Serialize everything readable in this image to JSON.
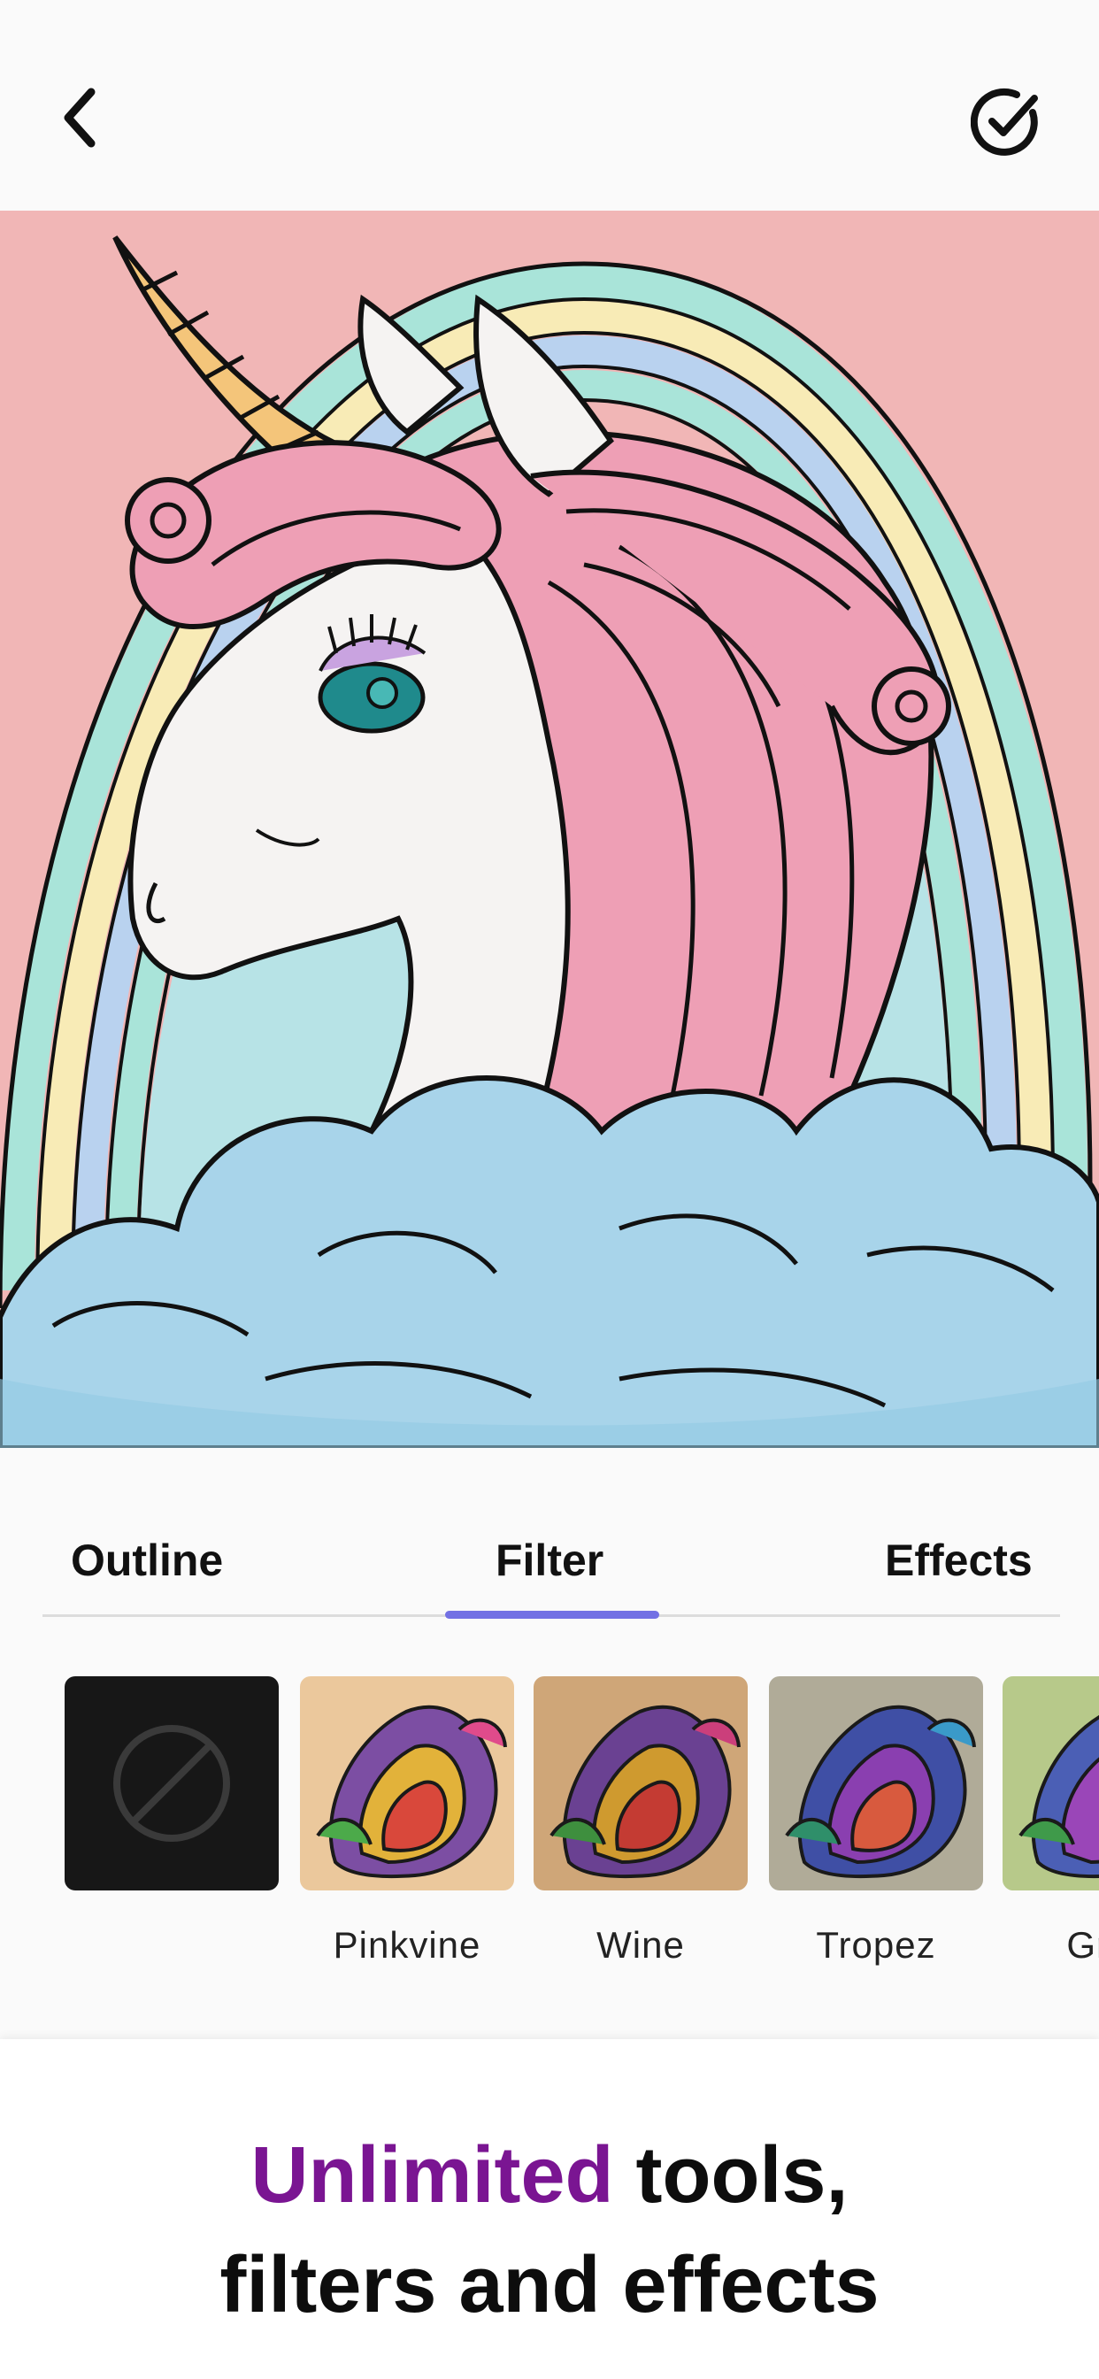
{
  "header": {
    "back_icon": "chevron-left-icon",
    "done_icon": "check-circle-icon"
  },
  "canvas": {
    "subject": "unicode-unicorn-coloring",
    "colors": {
      "background": "#f1b6b6",
      "mane": "#ee9fb5",
      "cloud": "#a8d4ea",
      "horn": "#f4c57a",
      "eye": "#1f8a8c"
    }
  },
  "tabs": {
    "items": [
      "Outline",
      "Filter",
      "Effects"
    ],
    "active": "Filter",
    "indicator_color": "#7371e4"
  },
  "filters": {
    "none_icon": "ban-icon",
    "items": [
      {
        "label": "",
        "kind": "none"
      },
      {
        "label": "Pinkvine",
        "tint": "#ebc89c"
      },
      {
        "label": "Wine",
        "tint": "#cfa678"
      },
      {
        "label": "Tropez",
        "tint": "#b0ab98"
      },
      {
        "label": "Gree",
        "tint": "#b7c98a"
      }
    ]
  },
  "promo": {
    "highlight": "Unlimited",
    "rest_line1": " tools,",
    "line2": "filters and effects",
    "highlight_color": "#7a1592"
  }
}
